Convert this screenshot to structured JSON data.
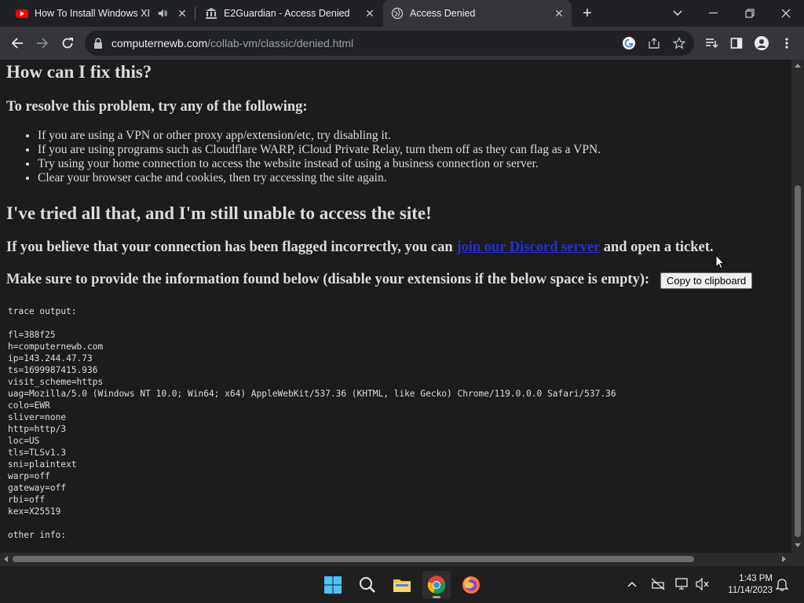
{
  "tabs": [
    {
      "title": "How To Install Windows XP",
      "favicon": "youtube-icon",
      "audio": "speaker-icon",
      "active": false
    },
    {
      "title": "E2Guardian - Access Denied",
      "favicon": "bank-icon",
      "active": false
    },
    {
      "title": "Access Denied",
      "favicon": "globe-icon",
      "active": true
    }
  ],
  "address_bar": {
    "domain": "computernewb.com",
    "path": "/collab-vm/classic/denied.html"
  },
  "page": {
    "heading_fix": "How can I fix this?",
    "subheading_resolve": "To resolve this problem, try any of the following:",
    "bullets": [
      "If you are using a VPN or other proxy app/extension/etc, try disabling it.",
      "If you are using programs such as Cloudflare WARP, iCloud Private Relay, turn them off as they can flag as a VPN.",
      "Try using your home connection to access the website instead of using a business connection or server.",
      "Clear your browser cache and cookies, then try accessing the site again."
    ],
    "heading_tried": "I've tried all that, and I'm still unable to access the site!",
    "flagged_before": "If you believe that your connection has been flagged incorrectly, you can ",
    "flagged_link": "join our Discord server",
    "flagged_after": " and open a ticket.",
    "provide_info": "Make sure to provide the information found below (disable your extensions if the below space is empty):",
    "copy_button": "Copy to clipboard",
    "trace_title": "trace output:",
    "trace_lines": [
      "fl=388f25",
      "h=computernewb.com",
      "ip=143.244.47.73",
      "ts=1699987415.936",
      "visit_scheme=https",
      "uag=Mozilla/5.0 (Windows NT 10.0; Win64; x64) AppleWebKit/537.36 (KHTML, like Gecko) Chrome/119.0.0.0 Safari/537.36",
      "colo=EWR",
      "sliver=none",
      "http=http/3",
      "loc=US",
      "tls=TLSv1.3",
      "sni=plaintext",
      "warp=off",
      "gateway=off",
      "rbi=off",
      "kex=X25519"
    ],
    "other_info": "other info:"
  },
  "taskbar": {
    "apps": [
      "windows-start-icon",
      "search-icon",
      "file-explorer-icon",
      "chrome-icon",
      "firefox-icon"
    ],
    "time": "1:43 PM",
    "date": "11/14/2023"
  },
  "colors": {
    "tab_bg": "#202124",
    "toolbar_bg": "#35363a",
    "page_bg": "#1c1c1c",
    "link": "#2b2bd6"
  }
}
